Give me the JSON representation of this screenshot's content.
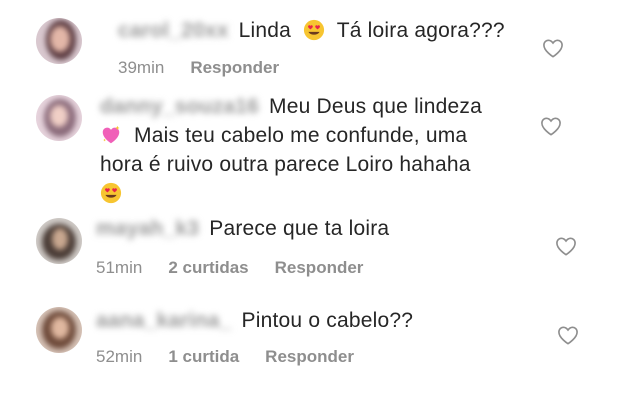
{
  "comments": [
    {
      "username": "carol_20xx",
      "text_before": "Linda",
      "text_after": "Tá loira agora???",
      "time": "39min",
      "likes": "",
      "reply": "Responder"
    },
    {
      "username": "danny_souza16",
      "line1": "Meu Deus que lindeza",
      "line2": "Mais teu cabelo me confunde, uma",
      "line3": "hora é ruivo outra parece Loiro hahaha",
      "time": "",
      "likes": "",
      "reply": ""
    },
    {
      "username": "mayah_k3",
      "text": "Parece que ta loira",
      "time": "51min",
      "likes": "2 curtidas",
      "reply": "Responder"
    },
    {
      "username": "aana_karina_",
      "text": "Pintou o cabelo??",
      "time": "52min",
      "likes": "1 curtida",
      "reply": "Responder"
    }
  ],
  "icons": {
    "like": "heart-outline-icon",
    "heart_eyes": "heart-eyes-emoji",
    "sparkling_heart": "sparkling-heart-emoji"
  },
  "colors": {
    "text": "#262626",
    "meta": "#8e8e8e",
    "emoji_face": "#f7c531",
    "emoji_heart": "#e8234a",
    "sparkle_heart": "#f060b8"
  }
}
